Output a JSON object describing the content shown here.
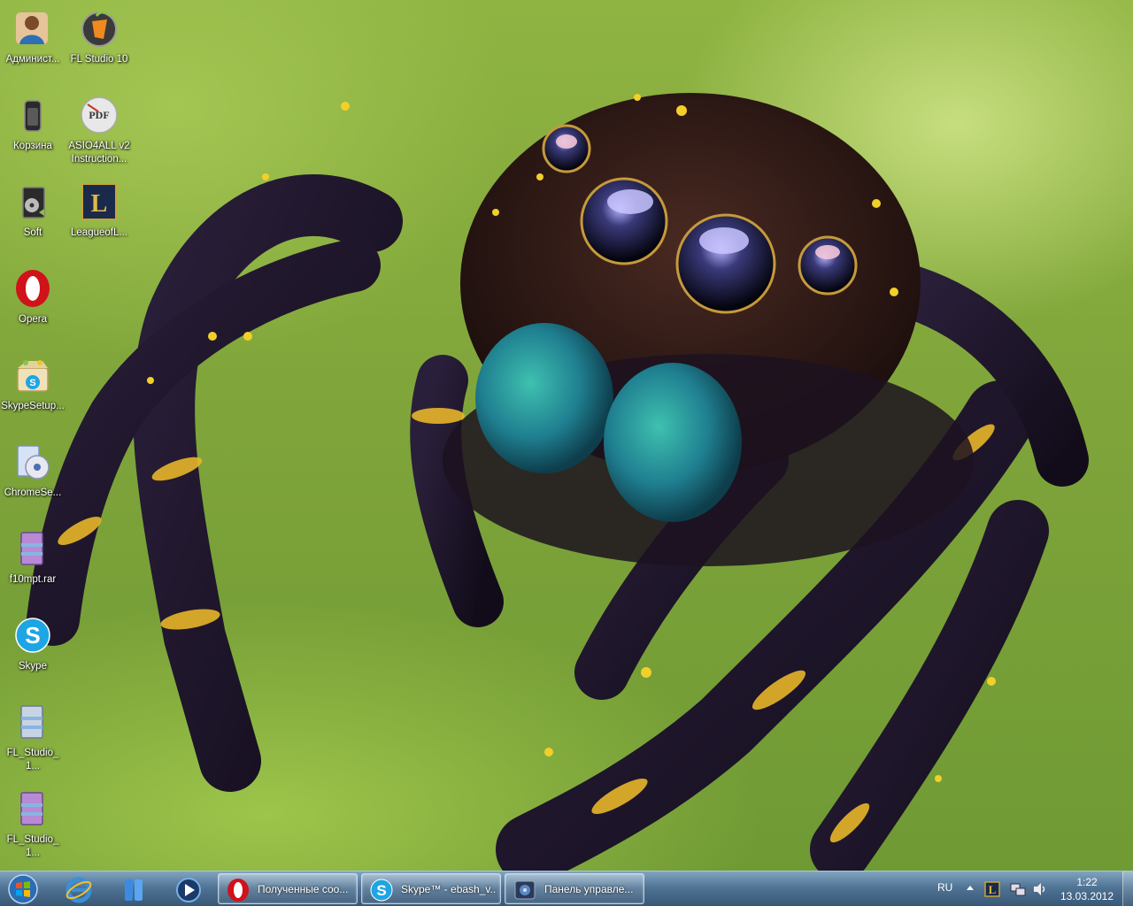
{
  "desktop": {
    "icons": [
      {
        "label": "Админист...",
        "icon": "user-account-icon"
      },
      {
        "label": "FL Studio 10",
        "icon": "fl-studio-icon"
      },
      {
        "label": "Корзина",
        "icon": "recycle-bin-icon"
      },
      {
        "label": "ASIO4ALL v2 Instruction...",
        "icon": "pdf-icon"
      },
      {
        "label": "Soft",
        "icon": "folder-icon"
      },
      {
        "label": "LeagueofL...",
        "icon": "league-of-legends-icon"
      },
      {
        "label": "Opera",
        "icon": "opera-icon"
      },
      {
        "label": "SkypeSetup...",
        "icon": "skype-setup-icon"
      },
      {
        "label": "ChromeSe...",
        "icon": "chrome-setup-icon"
      },
      {
        "label": "f10mpt.rar",
        "icon": "rar-archive-icon"
      },
      {
        "label": "Skype",
        "icon": "skype-icon"
      },
      {
        "label": "FL_Studio_1...",
        "icon": "rar-archive-icon"
      },
      {
        "label": "FL_Studio_1...",
        "icon": "rar-archive-icon"
      }
    ]
  },
  "taskbar": {
    "pinned": [
      {
        "icon": "start-orb-icon"
      },
      {
        "icon": "internet-explorer-icon"
      },
      {
        "icon": "windows-explorer-icon"
      },
      {
        "icon": "media-player-icon"
      }
    ],
    "windows": [
      {
        "label": "Полученные соо...",
        "icon": "opera-icon"
      },
      {
        "label": "Skype™ - ebash_v...",
        "icon": "skype-icon"
      },
      {
        "label": "Панель управле...",
        "icon": "control-panel-icon"
      }
    ],
    "tray": {
      "language": "RU",
      "icons": [
        "show-hidden-icons-icon",
        "league-of-legends-icon",
        "network-icon",
        "volume-icon"
      ],
      "time": "1:22",
      "date": "13.03.2012"
    }
  },
  "colors": {
    "wallpaper_green": "#8fb442",
    "taskbar": "#5a82ad",
    "opera_red": "#d0121b",
    "skype_blue": "#1ea5e4"
  }
}
